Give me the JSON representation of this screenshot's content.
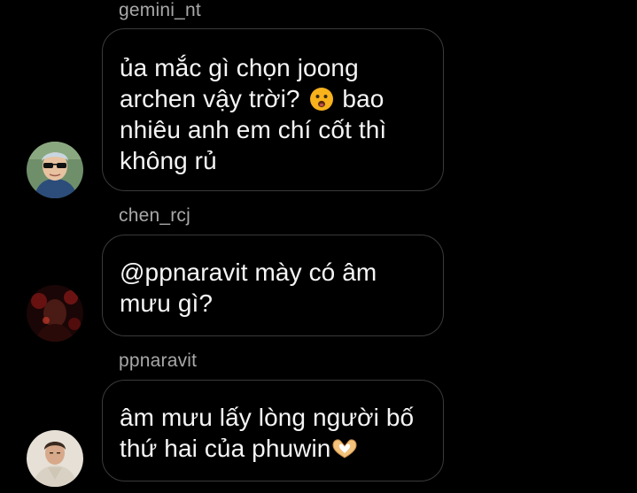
{
  "messages": [
    {
      "username": "gemini_nt",
      "text_line1": "ủa mắc gì chọn joong",
      "text_line2_a": "archen vậy trời?",
      "text_line2_b": "bao",
      "text_line3": "nhiêu anh em chí cốt thì",
      "text_line4": "không rủ",
      "emoji": "frowning-open-mouth-emoji",
      "avatar": "avatar-sunglasses"
    },
    {
      "username": "chen_rcj",
      "text_line1": "@ppnaravit mày có âm",
      "text_line2": "mưu gì?",
      "avatar": "avatar-dark-red"
    },
    {
      "username": "ppnaravit",
      "text_line1": "âm mưu lấy lòng người bố",
      "text_line2": "thứ hai của phuwin",
      "emoji": "heart-hands-emoji",
      "avatar": "avatar-light-shirt"
    }
  ],
  "colors": {
    "background": "#000000",
    "bubble_border": "#3a3a3a",
    "username": "#a8a8a8",
    "text": "#f5f5f5",
    "emoji_face": "#f7b21c",
    "emoji_hands": "#f4c27a"
  }
}
